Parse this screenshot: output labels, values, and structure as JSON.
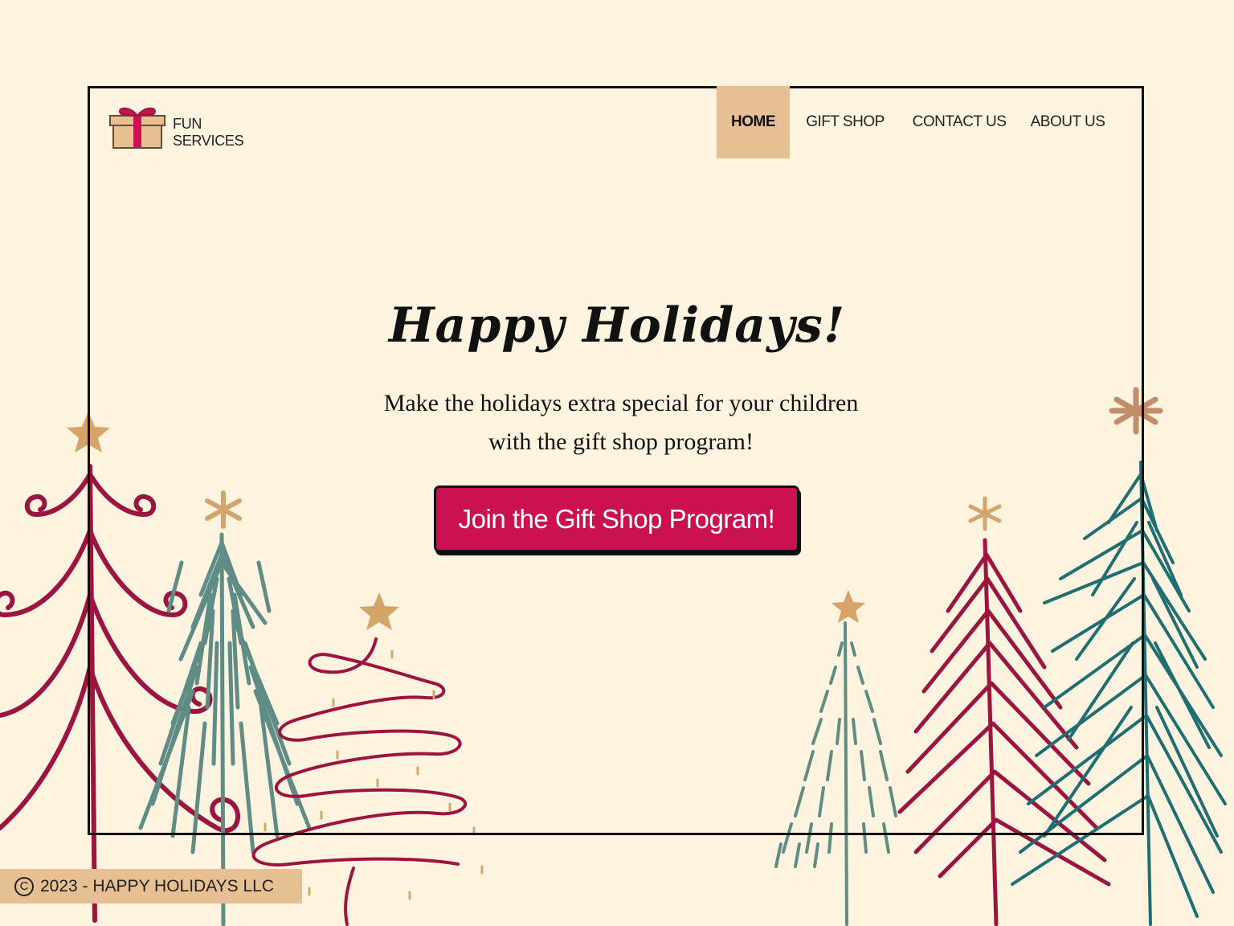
{
  "brand": {
    "line1": "FUN",
    "line2": "SERVICES",
    "logo_icon": "gift-box-icon"
  },
  "nav": {
    "items": [
      {
        "label": "HOME",
        "active": true
      },
      {
        "label": "GIFT SHOP",
        "active": false
      },
      {
        "label": "CONTACT US",
        "active": false
      },
      {
        "label": "ABOUT US",
        "active": false
      }
    ]
  },
  "hero": {
    "title": "Happy Holidays!",
    "subtitle_line1": "Make the holidays extra special for your children",
    "subtitle_line2": "with the gift shop program!",
    "cta_label": "Join the Gift Shop Program!"
  },
  "footer": {
    "symbol": "C",
    "text": "2023 - HAPPY HOLIDAYS LLC"
  },
  "colors": {
    "background": "#fdf3df",
    "accent_tan": "#e6bf92",
    "cta_red": "#cc1150",
    "tree_red": "#9c1440",
    "tree_teal": "#1f6e72",
    "tree_sage": "#5f8c84",
    "star_gold": "#d4a46a"
  }
}
